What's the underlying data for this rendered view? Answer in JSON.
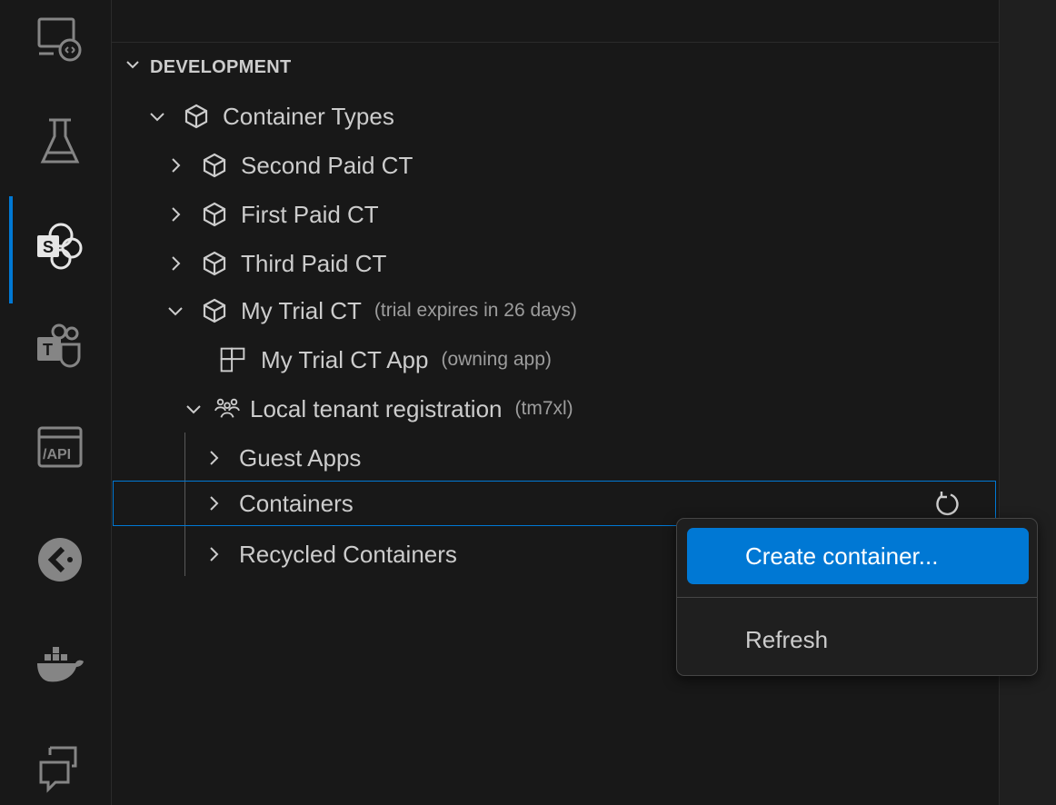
{
  "activity_bar": {
    "items": [
      {
        "name": "remote-explorer-icon"
      },
      {
        "name": "testing-icon"
      },
      {
        "name": "sharepoint-embedded-icon",
        "active": true
      },
      {
        "name": "teams-toolkit-icon"
      },
      {
        "name": "api-center-icon"
      },
      {
        "name": "extension-pie-icon"
      },
      {
        "name": "docker-icon"
      },
      {
        "name": "comments-icon"
      }
    ]
  },
  "section": {
    "title": "DEVELOPMENT"
  },
  "tree": {
    "container_types": {
      "label": "Container Types"
    },
    "second_paid": {
      "label": "Second Paid CT"
    },
    "first_paid": {
      "label": "First Paid CT"
    },
    "third_paid": {
      "label": "Third Paid CT"
    },
    "my_trial": {
      "label": "My Trial CT",
      "description": "(trial expires in 26 days)"
    },
    "my_trial_app": {
      "label": "My Trial CT App",
      "description": "(owning app)"
    },
    "local_tenant": {
      "label": "Local tenant registration",
      "description": "(tm7xl)"
    },
    "guest_apps": {
      "label": "Guest Apps"
    },
    "containers": {
      "label": "Containers"
    },
    "recycled": {
      "label": "Recycled Containers"
    }
  },
  "context_menu": {
    "create_label": "Create container...",
    "refresh_label": "Refresh"
  },
  "colors": {
    "accent": "#0078d4",
    "background": "#181818",
    "text": "#cccccc"
  }
}
